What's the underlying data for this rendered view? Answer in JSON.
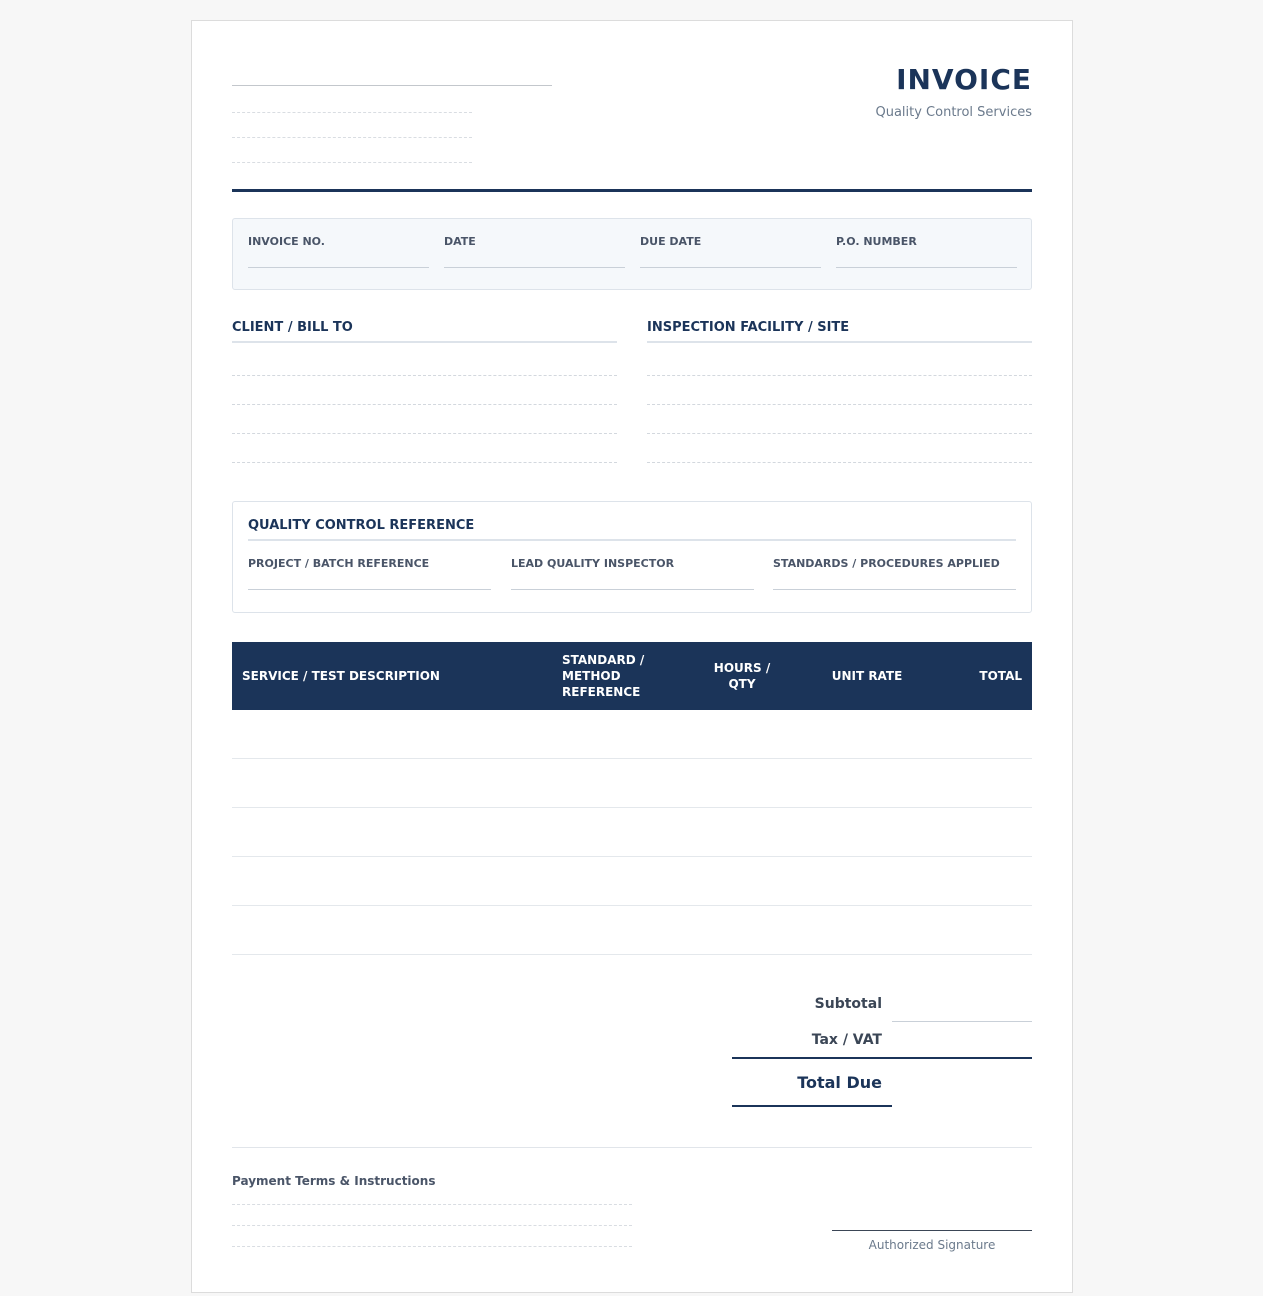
{
  "header": {
    "title": "INVOICE",
    "subtitle": "Quality Control Services"
  },
  "meta": {
    "fields": [
      {
        "label": "INVOICE NO."
      },
      {
        "label": "DATE"
      },
      {
        "label": "DUE DATE"
      },
      {
        "label": "P.O. NUMBER"
      }
    ]
  },
  "parties": {
    "client_title": "CLIENT / BILL TO",
    "facility_title": "INSPECTION FACILITY / SITE"
  },
  "qc": {
    "title": "QUALITY CONTROL REFERENCE",
    "fields": [
      {
        "label": "PROJECT / BATCH REFERENCE"
      },
      {
        "label": "LEAD QUALITY INSPECTOR"
      },
      {
        "label": "STANDARDS / PROCEDURES APPLIED"
      }
    ]
  },
  "table": {
    "columns": [
      "SERVICE / TEST DESCRIPTION",
      "STANDARD / METHOD REFERENCE",
      "HOURS / QTY",
      "UNIT RATE",
      "TOTAL"
    ]
  },
  "totals": {
    "subtotal_label": "Subtotal",
    "tax_label": "Tax / VAT",
    "total_label": "Total Due"
  },
  "footer": {
    "terms_title": "Payment Terms & Instructions",
    "signature_label": "Authorized Signature"
  }
}
